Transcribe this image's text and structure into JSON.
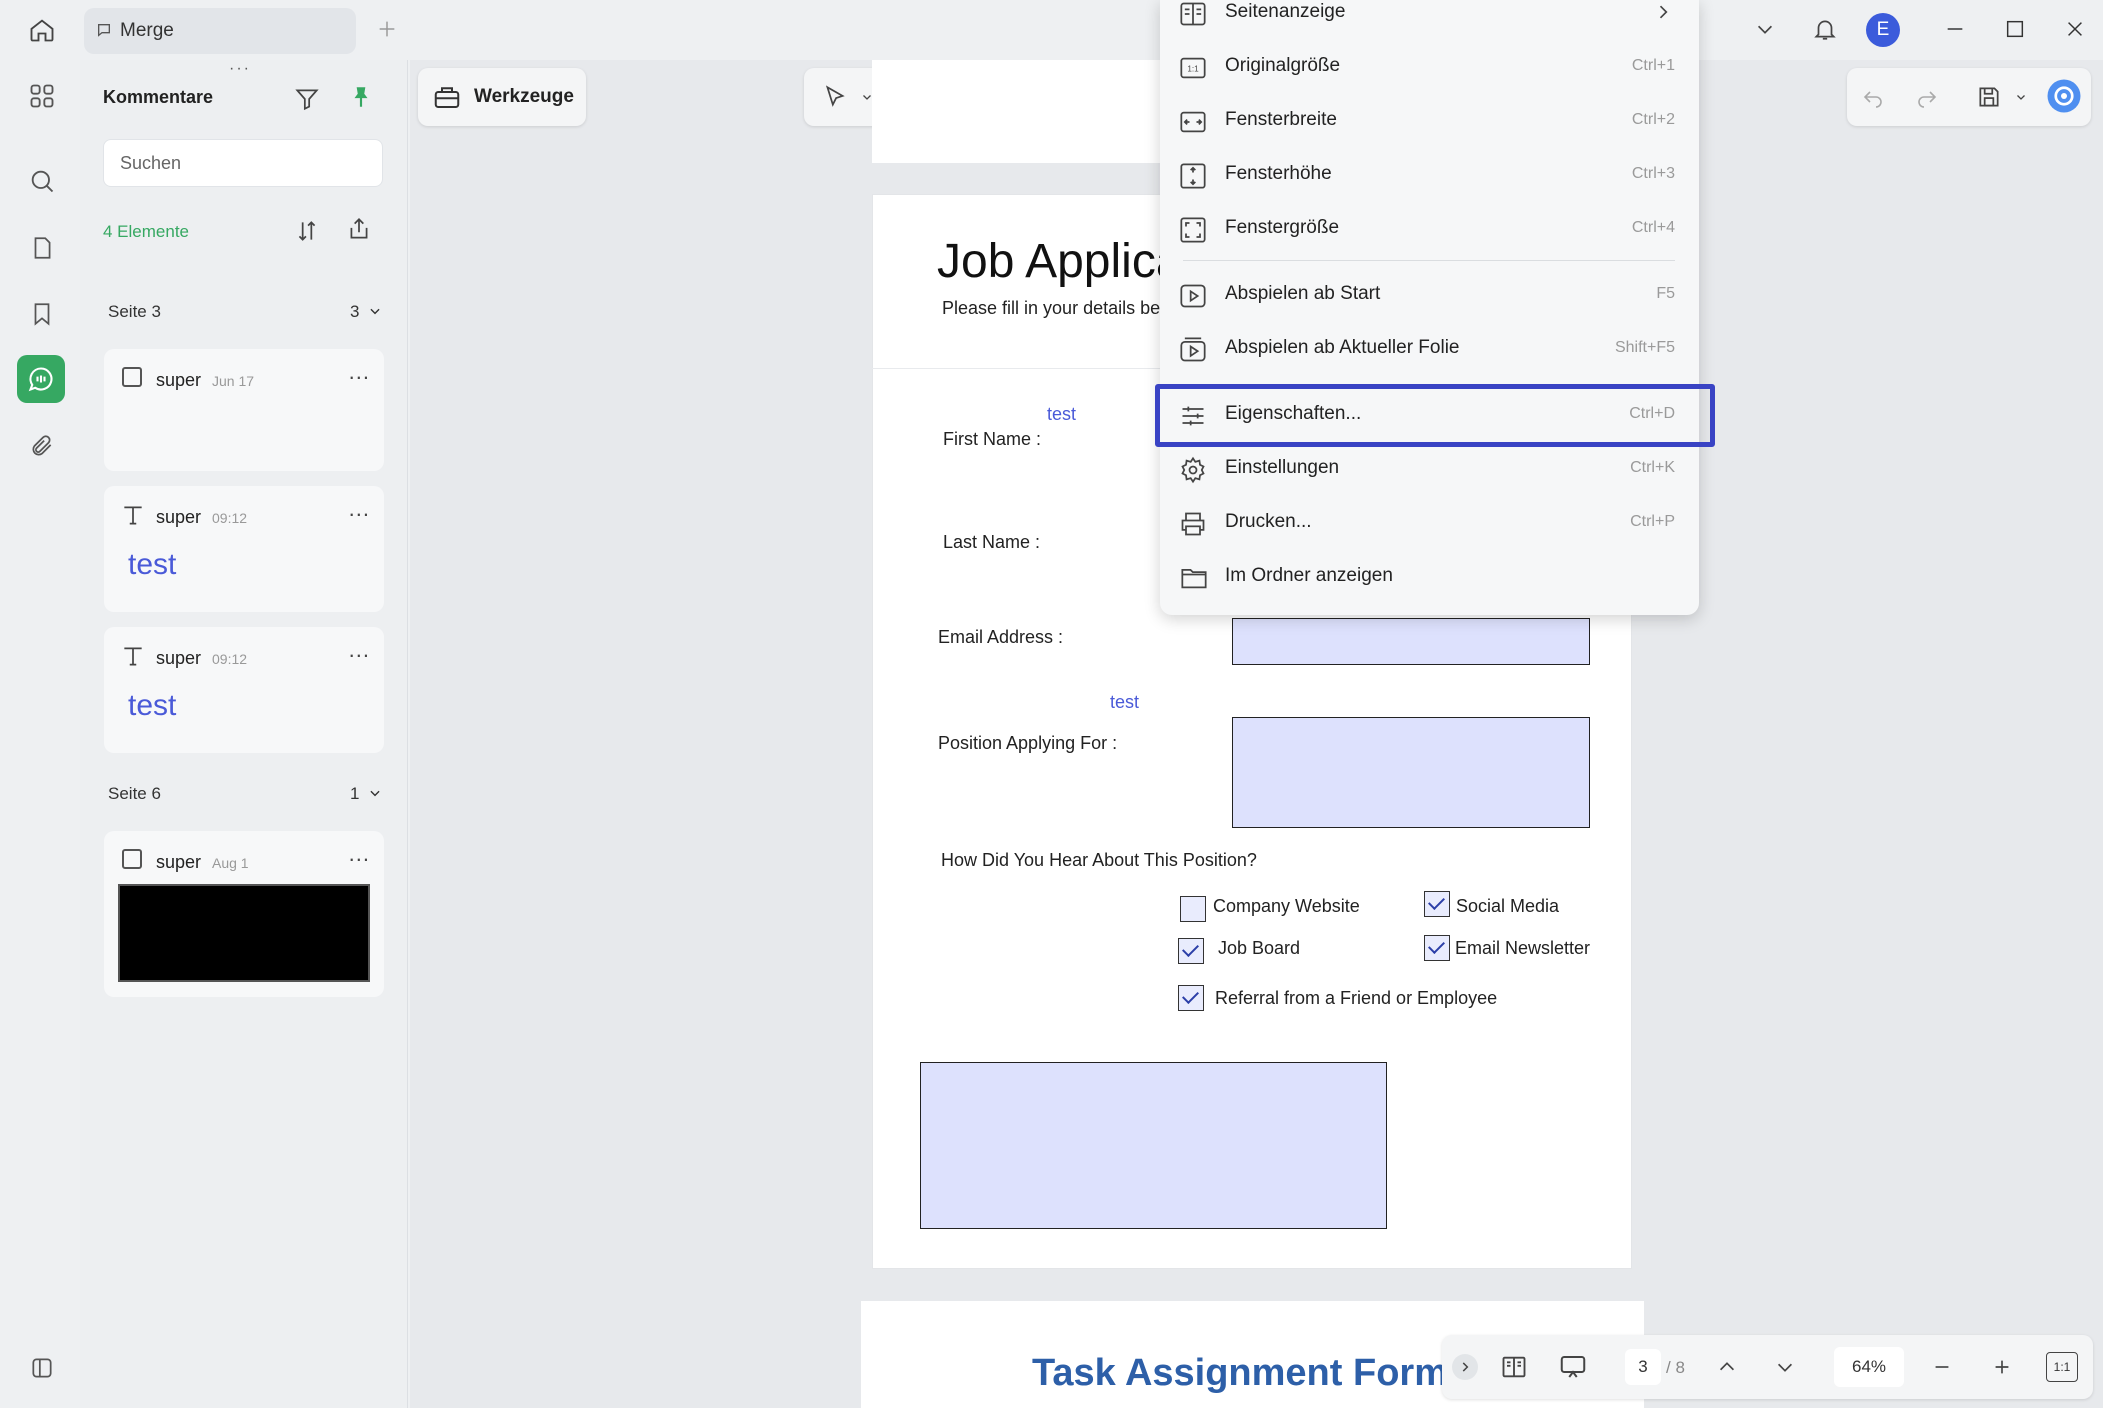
{
  "titlebar": {
    "tab_label": "Merge",
    "user_initial": "E",
    "icons": [
      "home-icon",
      "new-tab-icon",
      "chevron-down-icon",
      "bell-icon",
      "minimize-icon",
      "maximize-icon",
      "close-icon"
    ]
  },
  "left_rail": {
    "icons": [
      "thumbnails-icon",
      "search-icon",
      "pages-icon",
      "bookmark-icon",
      "comments-icon",
      "attachment-icon",
      "sidebar-toggle-icon"
    ],
    "active": "comments-icon"
  },
  "comments_panel": {
    "title": "Kommentare",
    "search_placeholder": "Suchen",
    "count_label": "4 Elemente",
    "groups": [
      {
        "page_label": "Seite 3",
        "count": "3",
        "items": [
          {
            "author": "super",
            "time": "Jun 17",
            "type": "checkbox",
            "body": ""
          },
          {
            "author": "super",
            "time": "09:12",
            "type": "text",
            "body": "test"
          },
          {
            "author": "super",
            "time": "09:12",
            "type": "text",
            "body": "test"
          }
        ]
      },
      {
        "page_label": "Seite 6",
        "count": "1",
        "items": [
          {
            "author": "super",
            "time": "Aug 1",
            "type": "checkbox",
            "body": ""
          }
        ]
      }
    ],
    "more_label": "..."
  },
  "toolbar": {
    "tools_label": "Werkzeuge",
    "accent": "#36a862"
  },
  "document": {
    "title": "Job Applica",
    "subtitle": "Please fill in your details bel",
    "fields": {
      "first_name": "First Name :",
      "last_name": "Last Name :",
      "email": "Email Address :",
      "position": "Position Applying For :",
      "hear": "How Did You Hear About This Position?"
    },
    "annotation_text_1": "test",
    "annotation_text_2": "test",
    "checkboxes": [
      {
        "label": "Company Website",
        "checked": false
      },
      {
        "label": "Social Media",
        "checked": true
      },
      {
        "label": "Job Board",
        "checked": true
      },
      {
        "label": "Email Newsletter",
        "checked": true
      },
      {
        "label": "Referral from a Friend or Employee",
        "checked": true
      }
    ],
    "next_page_title": "Task Assignment Form"
  },
  "bottom_bar": {
    "current_page": "3",
    "total_pages": "/ 8",
    "zoom": "64%",
    "fit_label": "1:1"
  },
  "menu": {
    "items": [
      {
        "label": "Seitenanzeige",
        "shortcut": "",
        "icon": "page-view-icon",
        "has_submenu": true
      },
      {
        "label": "Originalgröße",
        "shortcut": "Ctrl+1",
        "icon": "actual-size-icon"
      },
      {
        "label": "Fensterbreite",
        "shortcut": "Ctrl+2",
        "icon": "fit-width-icon"
      },
      {
        "label": "Fensterhöhe",
        "shortcut": "Ctrl+3",
        "icon": "fit-height-icon"
      },
      {
        "label": "Fenstergröße",
        "shortcut": "Ctrl+4",
        "icon": "fit-window-icon"
      },
      {
        "label": "Abspielen ab Start",
        "shortcut": "F5",
        "icon": "play-start-icon"
      },
      {
        "label": "Abspielen ab Aktueller Folie",
        "shortcut": "Shift+F5",
        "icon": "play-current-icon"
      },
      {
        "label": "Eigenschaften...",
        "shortcut": "Ctrl+D",
        "icon": "properties-icon",
        "highlighted": true
      },
      {
        "label": "Einstellungen",
        "shortcut": "Ctrl+K",
        "icon": "settings-icon"
      },
      {
        "label": "Drucken...",
        "shortcut": "Ctrl+P",
        "icon": "print-icon"
      },
      {
        "label": "Im Ordner anzeigen",
        "shortcut": "",
        "icon": "folder-icon"
      }
    ],
    "highlight_color": "#3943c4"
  }
}
